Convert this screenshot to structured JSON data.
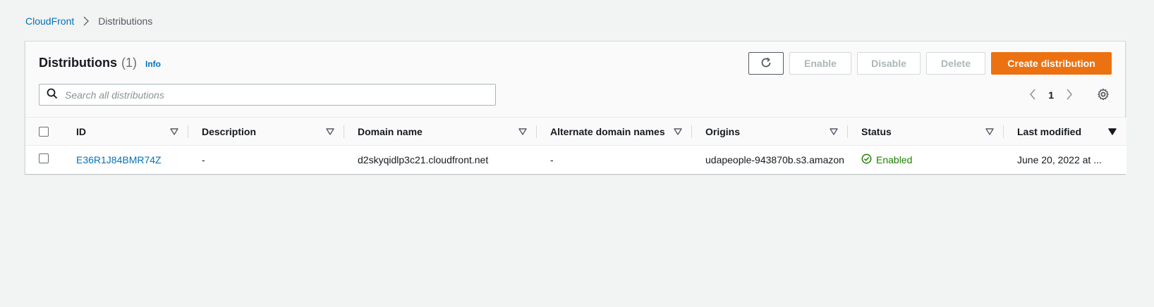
{
  "breadcrumb": {
    "root": "CloudFront",
    "current": "Distributions"
  },
  "header": {
    "title": "Distributions",
    "count": "(1)",
    "info": "Info"
  },
  "actions": {
    "enable": "Enable",
    "disable": "Disable",
    "delete": "Delete",
    "create": "Create distribution"
  },
  "search": {
    "placeholder": "Search all distributions"
  },
  "pagination": {
    "page": "1"
  },
  "table": {
    "columns": [
      "ID",
      "Description",
      "Domain name",
      "Alternate domain names",
      "Origins",
      "Status",
      "Last modified"
    ],
    "rows": [
      {
        "id": "E36R1J84BMR74Z",
        "description": "-",
        "domain": "d2skyqidlp3c21.cloudfront.net",
        "alternate": "-",
        "origins": "udapeople-943870b.s3.amazon",
        "status": "Enabled",
        "last_modified": "June 20, 2022 at ..."
      }
    ]
  },
  "colors": {
    "accent": "#ec7211",
    "link": "#0073bb",
    "success": "#1d8102"
  }
}
